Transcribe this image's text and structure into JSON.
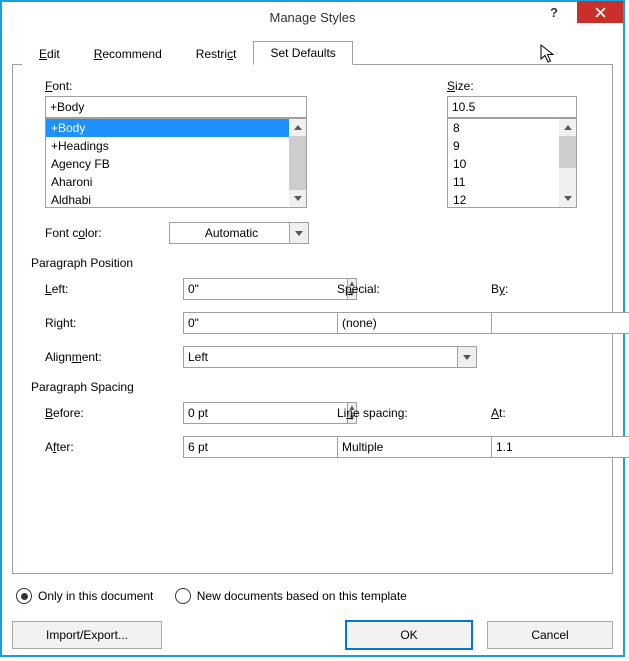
{
  "titlebar": {
    "title": "Manage Styles"
  },
  "tabs": {
    "edit": "Edit",
    "recommend": "Recommend",
    "restrict": "Restrict",
    "set_defaults": "Set Defaults"
  },
  "font": {
    "label": "Font:",
    "value": "+Body",
    "options": [
      "+Body",
      "+Headings",
      "Agency FB",
      "Aharoni",
      "Aldhabi"
    ]
  },
  "size": {
    "label": "Size:",
    "value": "10.5",
    "options": [
      "8",
      "9",
      "10",
      "11",
      "12"
    ]
  },
  "font_color": {
    "label": "Font color:",
    "value": "Automatic"
  },
  "position": {
    "label": "Paragraph Position",
    "left_label": "Left:",
    "left_value": "0\"",
    "right_label": "Right:",
    "right_value": "0\"",
    "special_label": "Special:",
    "special_value": "(none)",
    "by_label": "By:",
    "by_value": "",
    "align_label": "Alignment:",
    "align_value": "Left"
  },
  "spacing": {
    "label": "Paragraph Spacing",
    "before_label": "Before:",
    "before_value": "0 pt",
    "after_label": "After:",
    "after_value": "6 pt",
    "line_label": "Line spacing:",
    "line_value": "Multiple",
    "at_label": "At:",
    "at_value": "1.1"
  },
  "scope": {
    "only": "Only in this document",
    "new": "New documents based on this template"
  },
  "buttons": {
    "import": "Import/Export...",
    "ok": "OK",
    "cancel": "Cancel"
  }
}
